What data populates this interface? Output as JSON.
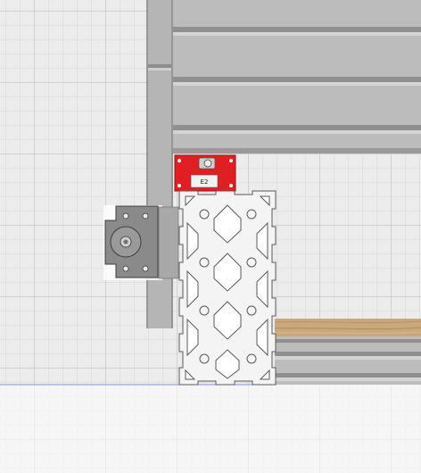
{
  "canvas": {
    "title": "",
    "background": "#ececec"
  },
  "parts": {
    "top_rail": {
      "name": "horizontal-extrusion-top",
      "color": "#b8b8b8"
    },
    "vertical_rail": {
      "name": "vertical-extrusion-left",
      "color": "#b3b3b3"
    },
    "endstop_plate": {
      "name": "red-endstop-plate",
      "color": "#e01f22",
      "label": "E2"
    },
    "motor_mount": {
      "name": "stepper-motor-mount-plate",
      "color": "#888888"
    },
    "profile_section": {
      "name": "aluminum-profile-cross-section",
      "color": "#f4f4f4"
    },
    "wood_panel": {
      "name": "wood-panel",
      "color": "#c9a97c"
    },
    "bottom_rail": {
      "name": "horizontal-extrusion-bottom",
      "color": "#b8b8b8"
    }
  },
  "icons": {
    "bolt": "bolt-icon"
  }
}
